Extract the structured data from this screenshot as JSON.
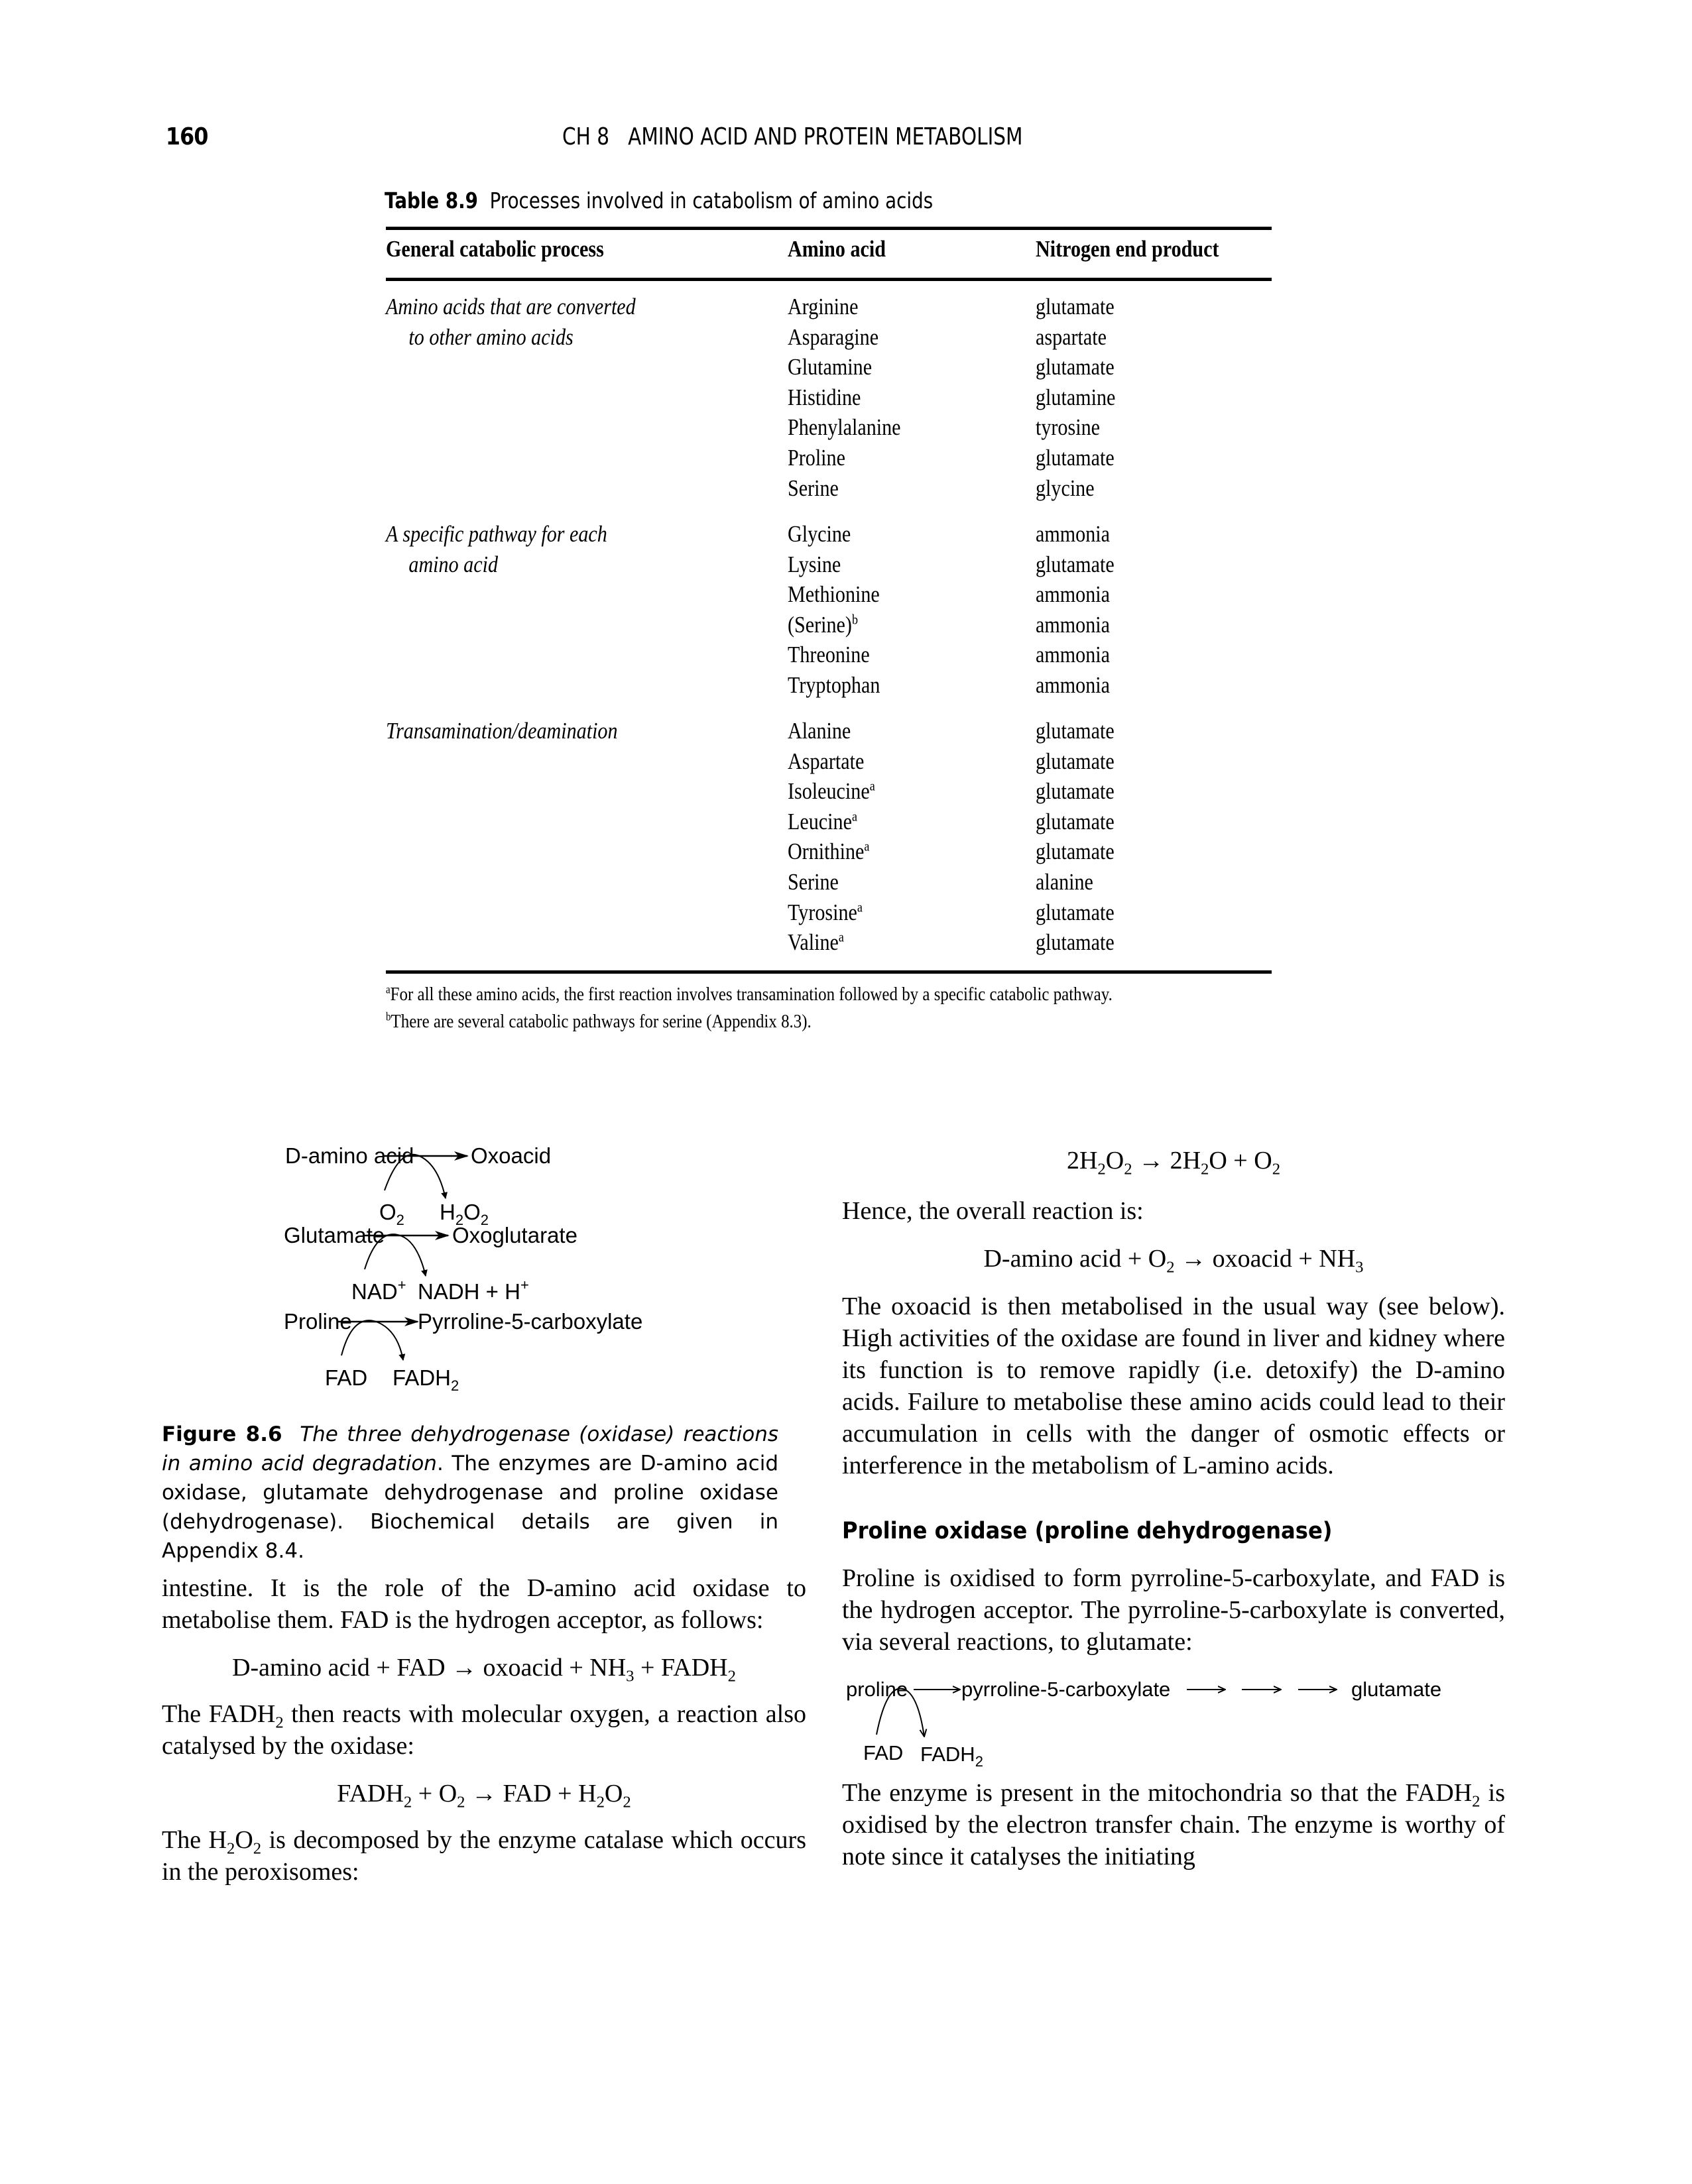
{
  "header": {
    "page_number": "160",
    "running_head": "CH 8   AMINO ACID AND PROTEIN METABOLISM"
  },
  "table": {
    "label": "Table 8.9",
    "title": "Processes involved in catabolism of amino acids",
    "columns": [
      "General catabolic process",
      "Amino acid",
      "Nitrogen end product"
    ],
    "groups": [
      {
        "process_line1": "Amino acids that are converted",
        "process_line2": "to other amino acids",
        "rows": [
          {
            "amino_acid": "Arginine",
            "sup": "",
            "product": "glutamate"
          },
          {
            "amino_acid": "Asparagine",
            "sup": "",
            "product": "aspartate"
          },
          {
            "amino_acid": "Glutamine",
            "sup": "",
            "product": "glutamate"
          },
          {
            "amino_acid": "Histidine",
            "sup": "",
            "product": "glutamine"
          },
          {
            "amino_acid": "Phenylalanine",
            "sup": "",
            "product": "tyrosine"
          },
          {
            "amino_acid": "Proline",
            "sup": "",
            "product": "glutamate"
          },
          {
            "amino_acid": "Serine",
            "sup": "",
            "product": "glycine"
          }
        ]
      },
      {
        "process_line1": "A specific pathway for each",
        "process_line2": "amino acid",
        "rows": [
          {
            "amino_acid": "Glycine",
            "sup": "",
            "product": "ammonia"
          },
          {
            "amino_acid": "Lysine",
            "sup": "",
            "product": "glutamate"
          },
          {
            "amino_acid": "Methionine",
            "sup": "",
            "product": "ammonia"
          },
          {
            "amino_acid": "(Serine)",
            "sup": "b",
            "product": "ammonia"
          },
          {
            "amino_acid": "Threonine",
            "sup": "",
            "product": "ammonia"
          },
          {
            "amino_acid": "Tryptophan",
            "sup": "",
            "product": "ammonia"
          }
        ]
      },
      {
        "process_line1": "Transamination/deamination",
        "process_line2": "",
        "rows": [
          {
            "amino_acid": "Alanine",
            "sup": "",
            "product": "glutamate"
          },
          {
            "amino_acid": "Aspartate",
            "sup": "",
            "product": "glutamate"
          },
          {
            "amino_acid": "Isoleucine",
            "sup": "a",
            "product": "glutamate"
          },
          {
            "amino_acid": "Leucine",
            "sup": "a",
            "product": "glutamate"
          },
          {
            "amino_acid": "Ornithine",
            "sup": "a",
            "product": "glutamate"
          },
          {
            "amino_acid": "Serine",
            "sup": "",
            "product": "alanine"
          },
          {
            "amino_acid": "Tyrosine",
            "sup": "a",
            "product": "glutamate"
          },
          {
            "amino_acid": "Valine",
            "sup": "a",
            "product": "glutamate"
          }
        ]
      }
    ],
    "footnotes": [
      {
        "mark": "a",
        "text": "For all these amino acids, the first reaction involves transamination followed by a specific catabolic pathway."
      },
      {
        "mark": "b",
        "text": "There are several catabolic pathways for serine (Appendix 8.3)."
      }
    ]
  },
  "figure": {
    "reactions": [
      {
        "substrate": "D-amino acid",
        "product": "Oxoacid",
        "cofactor_in": "O",
        "cofactor_in_sub": "2",
        "cofactor_out_a": "H",
        "cofactor_out_sub1": "2",
        "cofactor_out_b": "O",
        "cofactor_out_sub2": "2"
      },
      {
        "substrate": "Glutamate",
        "product": "Oxoglutarate",
        "cofactor_in": "NAD",
        "cofactor_in_sup": "+",
        "cofactor_out": "NADH + H",
        "cofactor_out_sup": "+"
      },
      {
        "substrate": "Proline",
        "product": "Pyrroline-5-carboxylate",
        "cofactor_in": "FAD",
        "cofactor_out": "FADH",
        "cofactor_out_sub": "2"
      }
    ],
    "caption_label": "Figure 8.6",
    "caption_title": "The three dehydrogenase (oxidase) reactions in amino acid degradation",
    "caption_body": ". The enzymes are D-amino acid oxidase, glutamate dehydrogenase and proline oxidase (dehydrogenase). Biochemical details are given in Appendix 8.4."
  },
  "left_column": {
    "para1": "intestine. It is the role of the D-amino acid oxidase to metabolise them. FAD is the hydrogen acceptor, as follows:",
    "eq1": "D-amino acid + FAD → oxoacid + NH",
    "eq1_sub": "3",
    "eq1_tail": " + FADH",
    "eq1_tail_sub": "2",
    "para2_a": "The FADH",
    "para2_sub": "2",
    "para2_b": " then reacts with molecular oxygen, a reaction also catalysed by the oxidase:",
    "eq2": {
      "a": "FADH",
      "a_sub": "2",
      "b": " + O",
      "b_sub": "2",
      "c": " → FAD + H",
      "c_sub": "2",
      "d": "O",
      "d_sub": "2"
    },
    "para3_a": "The H",
    "para3_sub1": "2",
    "para3_b": "O",
    "para3_sub2": "2",
    "para3_c": " is decomposed by the enzyme catalase which occurs in the peroxisomes:"
  },
  "right_column": {
    "eq_catalase": {
      "a": "2H",
      "a_sub": "2",
      "b": "O",
      "b_sub": "2",
      "c": " → 2H",
      "c_sub": "2",
      "d": "O + O",
      "d_sub": "2"
    },
    "para1": "Hence, the overall reaction is:",
    "eq_overall": {
      "a": "D-amino acid + O",
      "a_sub": "2",
      "b": " → oxoacid + NH",
      "b_sub": "3"
    },
    "para2": "The oxoacid is then metabolised in the usual way (see below). High activities of the oxidase are found in liver and kidney where its function is to remove rapidly (i.e. detoxify) the D-amino acids. Failure to metabolise these amino acids could lead to their accumulation in cells with the danger of osmotic effects or interference in the metabolism of L-amino acids.",
    "section_heading": "Proline oxidase (proline dehydrogenase)",
    "para3": "Proline is oxidised to form pyrroline-5-carboxylate, and FAD is the hydrogen acceptor. The pyrroline-5-carboxylate is converted, via several reactions, to glutamate:",
    "scheme": {
      "substrate": "proline",
      "intermediate": "pyrroline-5-carboxylate",
      "product": "glutamate",
      "cofactor_in": "FAD",
      "cofactor_out": "FADH",
      "cofactor_out_sub": "2"
    },
    "para4_a": "The enzyme is present in the mitochondria so that the FADH",
    "para4_sub": "2",
    "para4_b": " is oxidised by the electron transfer chain. The enzyme is worthy of note since it catalyses the initiating"
  }
}
